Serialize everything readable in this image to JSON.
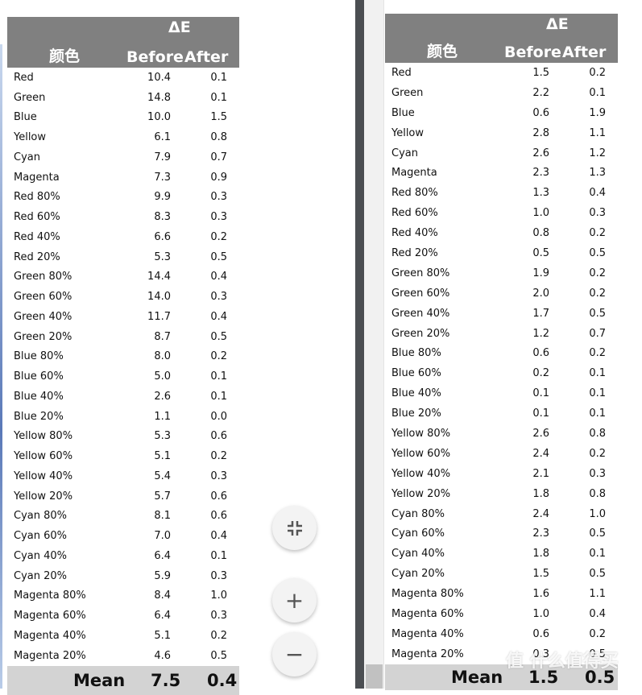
{
  "left_table": {
    "header": {
      "delta_e": "ΔE",
      "color_col": "颜色",
      "before": "Before",
      "after": "After"
    },
    "rows": [
      [
        "Red",
        "10.4",
        "0.1"
      ],
      [
        "Green",
        "14.8",
        "0.1"
      ],
      [
        "Blue",
        "10.0",
        "1.5"
      ],
      [
        "Yellow",
        "6.1",
        "0.8"
      ],
      [
        "Cyan",
        "7.9",
        "0.7"
      ],
      [
        "Magenta",
        "7.3",
        "0.9"
      ],
      [
        "Red 80%",
        "9.9",
        "0.3"
      ],
      [
        "Red 60%",
        "8.3",
        "0.3"
      ],
      [
        "Red 40%",
        "6.6",
        "0.2"
      ],
      [
        "Red 20%",
        "5.3",
        "0.5"
      ],
      [
        "Green 80%",
        "14.4",
        "0.4"
      ],
      [
        "Green 60%",
        "14.0",
        "0.3"
      ],
      [
        "Green 40%",
        "11.7",
        "0.4"
      ],
      [
        "Green 20%",
        "8.7",
        "0.5"
      ],
      [
        "Blue 80%",
        "8.0",
        "0.2"
      ],
      [
        "Blue 60%",
        "5.0",
        "0.1"
      ],
      [
        "Blue 40%",
        "2.6",
        "0.1"
      ],
      [
        "Blue 20%",
        "1.1",
        "0.0"
      ],
      [
        "Yellow 80%",
        "5.3",
        "0.6"
      ],
      [
        "Yellow 60%",
        "5.1",
        "0.2"
      ],
      [
        "Yellow 40%",
        "5.4",
        "0.3"
      ],
      [
        "Yellow 20%",
        "5.7",
        "0.6"
      ],
      [
        "Cyan 80%",
        "8.1",
        "0.6"
      ],
      [
        "Cyan 60%",
        "7.0",
        "0.4"
      ],
      [
        "Cyan 40%",
        "6.4",
        "0.1"
      ],
      [
        "Cyan 20%",
        "5.9",
        "0.3"
      ],
      [
        "Magenta 80%",
        "8.4",
        "1.0"
      ],
      [
        "Magenta 60%",
        "6.4",
        "0.3"
      ],
      [
        "Magenta 40%",
        "5.1",
        "0.2"
      ],
      [
        "Magenta 20%",
        "4.6",
        "0.5"
      ]
    ],
    "mean": {
      "label": "Mean",
      "before": "7.5",
      "after": "0.4"
    }
  },
  "right_table": {
    "header": {
      "delta_e": "ΔE",
      "color_col": "颜色",
      "before": "Before",
      "after": "After"
    },
    "rows": [
      [
        "Red",
        "1.5",
        "0.2"
      ],
      [
        "Green",
        "2.2",
        "0.1"
      ],
      [
        "Blue",
        "0.6",
        "1.9"
      ],
      [
        "Yellow",
        "2.8",
        "1.1"
      ],
      [
        "Cyan",
        "2.6",
        "1.2"
      ],
      [
        "Magenta",
        "2.3",
        "1.3"
      ],
      [
        "Red 80%",
        "1.3",
        "0.4"
      ],
      [
        "Red 60%",
        "1.0",
        "0.3"
      ],
      [
        "Red 40%",
        "0.8",
        "0.2"
      ],
      [
        "Red 20%",
        "0.5",
        "0.5"
      ],
      [
        "Green 80%",
        "1.9",
        "0.2"
      ],
      [
        "Green 60%",
        "2.0",
        "0.2"
      ],
      [
        "Green 40%",
        "1.7",
        "0.5"
      ],
      [
        "Green 20%",
        "1.2",
        "0.7"
      ],
      [
        "Blue 80%",
        "0.6",
        "0.2"
      ],
      [
        "Blue 60%",
        "0.2",
        "0.1"
      ],
      [
        "Blue 40%",
        "0.1",
        "0.1"
      ],
      [
        "Blue 20%",
        "0.1",
        "0.1"
      ],
      [
        "Yellow 80%",
        "2.6",
        "0.8"
      ],
      [
        "Yellow 60%",
        "2.4",
        "0.2"
      ],
      [
        "Yellow 40%",
        "2.1",
        "0.3"
      ],
      [
        "Yellow 20%",
        "1.8",
        "0.8"
      ],
      [
        "Cyan 80%",
        "2.4",
        "1.0"
      ],
      [
        "Cyan 60%",
        "2.3",
        "0.5"
      ],
      [
        "Cyan 40%",
        "1.8",
        "0.1"
      ],
      [
        "Cyan 20%",
        "1.5",
        "0.5"
      ],
      [
        "Magenta 80%",
        "1.6",
        "1.1"
      ],
      [
        "Magenta 60%",
        "1.0",
        "0.4"
      ],
      [
        "Magenta 40%",
        "0.6",
        "0.2"
      ],
      [
        "Magenta 20%",
        "0.3",
        "0.5"
      ]
    ],
    "mean": {
      "label": "Mean",
      "before": "1.5",
      "after": "0.5"
    }
  },
  "controls": {
    "fit_icon": "exit-fullscreen-icon",
    "zoom_in": "+",
    "zoom_out": "−"
  },
  "watermark": "值 什么值得买"
}
